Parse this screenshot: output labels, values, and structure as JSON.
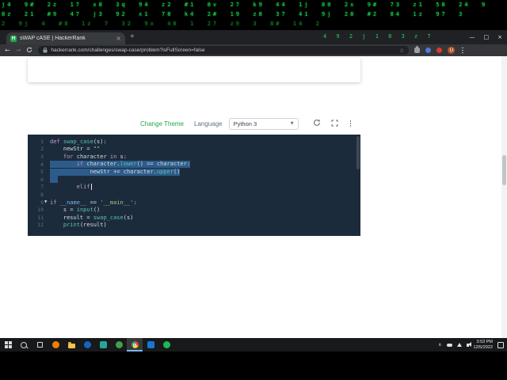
{
  "matrix": {
    "color": "#1fd750",
    "rows": [
      "j4  9#  2z  17  x8  3q  94  z2  #1  8v  27  k9  44  1j  80  2x  9#  73  z1  58  24  9",
      "8z  21  #9  47  j3  92  x1  78  k4  2#  19  z8  37  41  9j  28  #2  84  1z  97  3",
      "2  9j  4  #8  1z  7  32  9x  48  1  27  z9  3  8#  14  2"
    ],
    "tab_row": "4 9 2 j 1 8 3 z 7"
  },
  "browser": {
    "tab_title": "sWAP cASE | HackerRank",
    "favicon_letter": "H",
    "tab_close_glyph": "×",
    "new_tab_label": "+",
    "window_controls": {
      "minimize": "—",
      "maximize": "□",
      "close": "×"
    },
    "nav": {
      "back": "←",
      "forward": "→"
    },
    "url": "hackerrank.com/challenges/swap-case/problem?isFullScreen=false",
    "bookmark_star": "☆",
    "avatar_letter": "U",
    "extension_dot_colors": {
      "blue": "#4d7bd6",
      "red": "#d93b30"
    }
  },
  "toolbar": {
    "change_theme_label": "Change Theme",
    "language_label": "Language",
    "language_value": "Python 3",
    "select_caret": "▼"
  },
  "editor": {
    "background": "#1c2b3b",
    "selection_color": "#2d5c8a",
    "fold_caret_glyph": "▼",
    "lines": [
      {
        "n": 1,
        "t": [
          [
            "kw",
            "def"
          ],
          [
            "pl",
            " "
          ],
          [
            "fn",
            "swap_case"
          ],
          [
            "pl",
            "(s):"
          ]
        ]
      },
      {
        "n": 2,
        "t": [
          [
            "pl",
            "    newStr "
          ],
          [
            "op",
            "="
          ],
          [
            "pl",
            " "
          ],
          [
            "st",
            "\"\""
          ]
        ]
      },
      {
        "n": 3,
        "t": [
          [
            "pl",
            "    "
          ],
          [
            "kw",
            "for"
          ],
          [
            "pl",
            " character "
          ],
          [
            "kw",
            "in"
          ],
          [
            "pl",
            " s:"
          ]
        ]
      },
      {
        "n": 4,
        "sel": true,
        "t": [
          [
            "pl",
            "        "
          ],
          [
            "kw",
            "if"
          ],
          [
            "pl",
            " character."
          ],
          [
            "fn",
            "lower"
          ],
          [
            "pl",
            "() "
          ],
          [
            "op",
            "=="
          ],
          [
            "pl",
            " character:"
          ]
        ]
      },
      {
        "n": 5,
        "sel": true,
        "t": [
          [
            "pl",
            "            newStr "
          ],
          [
            "op",
            "+="
          ],
          [
            "pl",
            " character."
          ],
          [
            "fn",
            "upper"
          ],
          [
            "pl",
            "()"
          ]
        ]
      },
      {
        "n": 6,
        "selBlock": true,
        "t": []
      },
      {
        "n": 7,
        "cursor": true,
        "t": [
          [
            "pl",
            "        "
          ],
          [
            "kw",
            "elif"
          ]
        ]
      },
      {
        "n": 8,
        "t": []
      },
      {
        "n": 9,
        "fold": true,
        "t": [
          [
            "kw",
            "if"
          ],
          [
            "pl",
            " "
          ],
          [
            "dn",
            "__name__"
          ],
          [
            "pl",
            " "
          ],
          [
            "op",
            "=="
          ],
          [
            "pl",
            " "
          ],
          [
            "st",
            "'__main__'"
          ],
          [
            "pl",
            ":"
          ]
        ]
      },
      {
        "n": 10,
        "t": [
          [
            "pl",
            "    s "
          ],
          [
            "op",
            "="
          ],
          [
            "pl",
            " "
          ],
          [
            "bi",
            "input"
          ],
          [
            "pl",
            "()"
          ]
        ]
      },
      {
        "n": 11,
        "t": [
          [
            "pl",
            "    result "
          ],
          [
            "op",
            "="
          ],
          [
            "pl",
            " "
          ],
          [
            "fn",
            "swap_case"
          ],
          [
            "pl",
            "(s)"
          ]
        ]
      },
      {
        "n": 12,
        "t": [
          [
            "pl",
            "    "
          ],
          [
            "bi",
            "print"
          ],
          [
            "pl",
            "(result)"
          ]
        ]
      }
    ]
  },
  "taskbar": {
    "apps": [
      {
        "kind": "start",
        "name": "start-button"
      },
      {
        "kind": "search",
        "name": "search-button"
      },
      {
        "kind": "taskview",
        "name": "task-view-button"
      },
      {
        "kind": "circle",
        "color": "#f57c00",
        "name": "firefox-app"
      },
      {
        "kind": "folder",
        "name": "file-explorer-app"
      },
      {
        "kind": "circle",
        "color": "#1565c0",
        "name": "edge-app"
      },
      {
        "kind": "square",
        "color": "#26a69a",
        "name": "store-app"
      },
      {
        "kind": "circle",
        "color": "#43a047",
        "name": "whatsapp-app"
      },
      {
        "kind": "chrome",
        "active": true,
        "name": "chrome-app"
      },
      {
        "kind": "square",
        "color": "#1976d2",
        "name": "vscode-app"
      },
      {
        "kind": "circle",
        "color": "#1db954",
        "name": "spotify-app"
      }
    ],
    "tray": {
      "expand_glyph": "∧",
      "time": "3:53 PM",
      "date": "12/5/2022"
    }
  },
  "icons": {
    "favicon": "hackerrank-logo",
    "lock-icon": "https-padlock",
    "reset-code-icon": "circular-arrow",
    "fullscreen-icon": "corner-brackets",
    "more-options-icon": "vertical-kebab",
    "hidden-icons-chevron": "∧",
    "onedrive-icon": "cloud",
    "network-icon": "wedge",
    "volume-icon": "speaker",
    "action-center-icon": "outline-square"
  }
}
